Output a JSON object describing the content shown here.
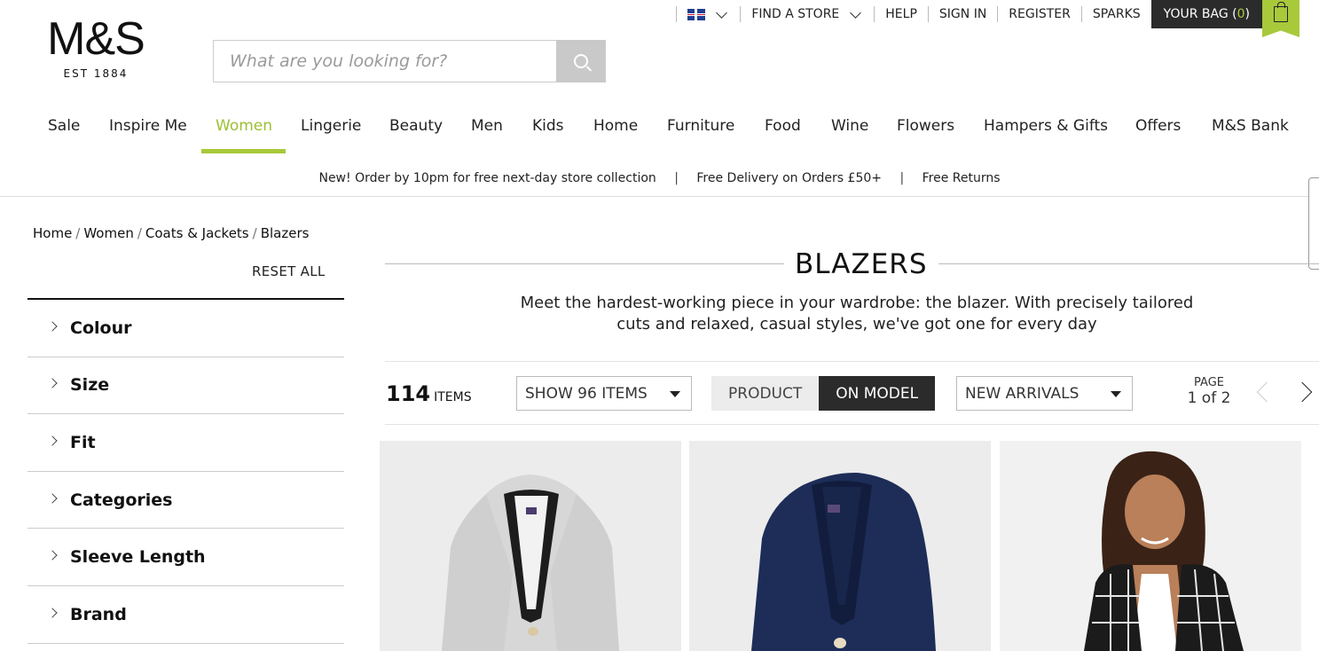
{
  "header": {
    "logo": {
      "brand": "M&S",
      "est": "EST 1884"
    },
    "utility": {
      "find_store": "FIND A STORE",
      "help": "HELP",
      "sign_in": "SIGN IN",
      "register": "REGISTER",
      "sparks": "SPARKS",
      "bag_label": "YOUR BAG (",
      "bag_count": " 0 ",
      "bag_close": ")"
    },
    "search": {
      "placeholder": "What are you looking for?"
    }
  },
  "nav": {
    "items": [
      "Sale",
      "Inspire Me",
      "Women",
      "Lingerie",
      "Beauty",
      "Men",
      "Kids",
      "Home",
      "Furniture",
      "Food",
      "Wine",
      "Flowers",
      "Hampers & Gifts",
      "Offers",
      "M&S Bank"
    ],
    "active": "Women"
  },
  "promo": {
    "messages": [
      "New! Order by 10pm for free next-day store collection",
      "Free Delivery on Orders £50+",
      "Free Returns"
    ],
    "separator": "|"
  },
  "breadcrumb": {
    "items": [
      "Home",
      "Women",
      "Coats & Jackets",
      "Blazers"
    ],
    "separator": "/"
  },
  "filters": {
    "reset_label": "RESET ALL",
    "facets": [
      "Colour",
      "Size",
      "Fit",
      "Categories",
      "Sleeve Length",
      "Brand"
    ]
  },
  "listing": {
    "title": "BLAZERS",
    "description": "Meet the hardest-working piece in your wardrobe: the blazer. With precisely tailored cuts and relaxed, casual styles, we've got one for every day",
    "count": "114",
    "count_label": "ITEMS",
    "show_select": "SHOW 96 ITEMS",
    "view_product": "PRODUCT",
    "view_model": "ON MODEL",
    "sort_select": "NEW ARRIVALS",
    "page_label": "PAGE",
    "page_value": "1 of 2"
  },
  "colors": {
    "accent": "#a8c93a",
    "dark": "#2b2b2b",
    "navy_blazer": "#1d2d58",
    "grey_blazer": "#d6d6d6"
  },
  "icons": [
    "uk-flag-icon",
    "chevron-down-icon",
    "search-icon",
    "shopping-bag-icon",
    "chevron-right-icon",
    "chevron-left-icon",
    "dropdown-triangle-icon"
  ]
}
